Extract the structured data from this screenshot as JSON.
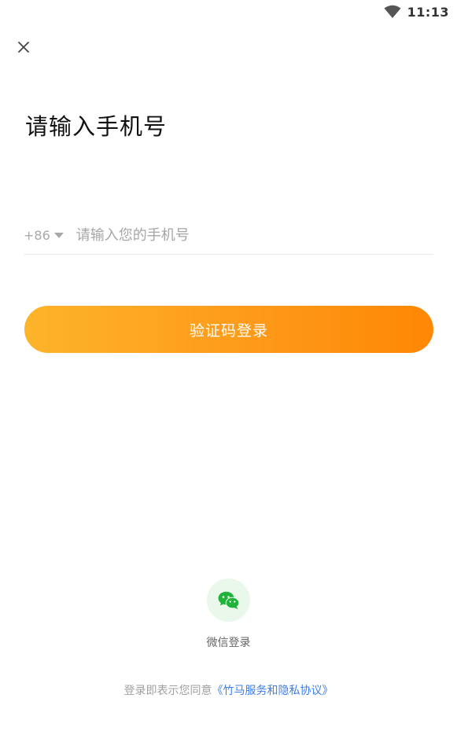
{
  "status_bar": {
    "time": "11:13",
    "icons": [
      "wifi-icon"
    ]
  },
  "header": {
    "close_icon": "close-icon",
    "title": "请输入手机号"
  },
  "phone_form": {
    "country_code": "+86",
    "phone_placeholder": "请输入您的手机号",
    "phone_value": "",
    "submit_label": "验证码登录"
  },
  "wechat": {
    "icon": "wechat-icon",
    "label": "微信登录"
  },
  "agreement": {
    "prefix": "登录即表示您同意",
    "link_text": "《竹马服务和隐私协议》"
  },
  "colors": {
    "button_gradient_start": "#fdb42b",
    "button_gradient_end": "#ff8705",
    "wechat_green": "#21b23a",
    "wechat_circle_bg": "#eaf8ec",
    "link_blue": "#3d7ee8"
  }
}
